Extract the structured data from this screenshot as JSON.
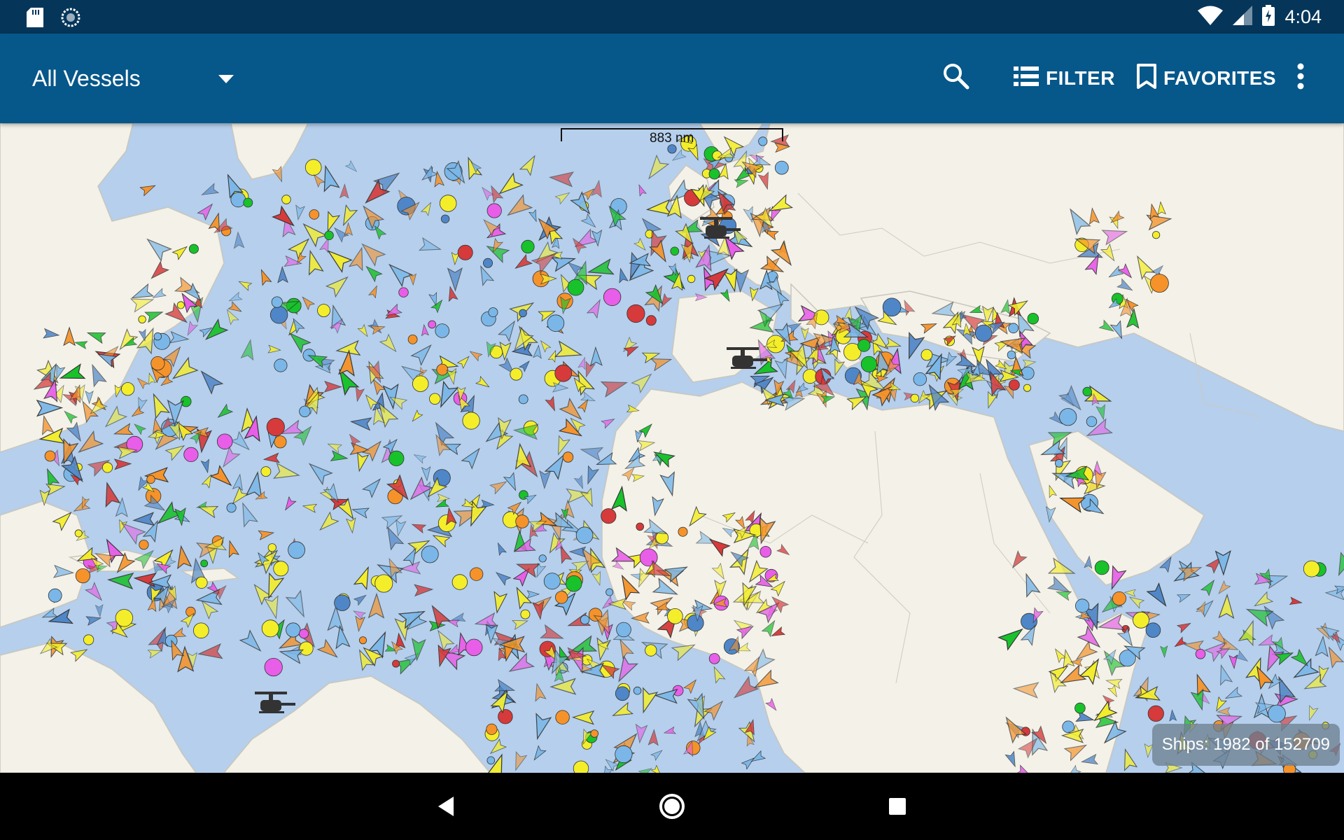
{
  "status_bar": {
    "time": "4:04",
    "left_icons": [
      "sd-card-icon",
      "sync-icon"
    ],
    "right_icons": [
      "wifi-icon",
      "signal-icon",
      "battery-charging-icon"
    ]
  },
  "toolbar": {
    "vessel_filter_value": "All Vessels",
    "search_icon": "search-icon",
    "filter_label": "FILTER",
    "favorites_label": "FAVORITES",
    "more_icon": "more-vert-icon"
  },
  "map": {
    "scale_label": "883 nm",
    "ships_count_text": "Ships: 1982 of 152709",
    "colors": {
      "water": "#b5cfec",
      "land": "#f3f1e8",
      "border": "#c9c6bc",
      "cargo": "#f4ee2a",
      "tanker": "#f5932a",
      "passenger": "#4f86c7",
      "fishing": "#d63a3a",
      "tug": "#18c22a",
      "pleasure": "#e85ee8",
      "other": "#7ab7e8"
    }
  },
  "nav_bar": {
    "back_icon": "back-triangle-icon",
    "home_icon": "home-circle-icon",
    "recent_icon": "recent-square-icon"
  }
}
